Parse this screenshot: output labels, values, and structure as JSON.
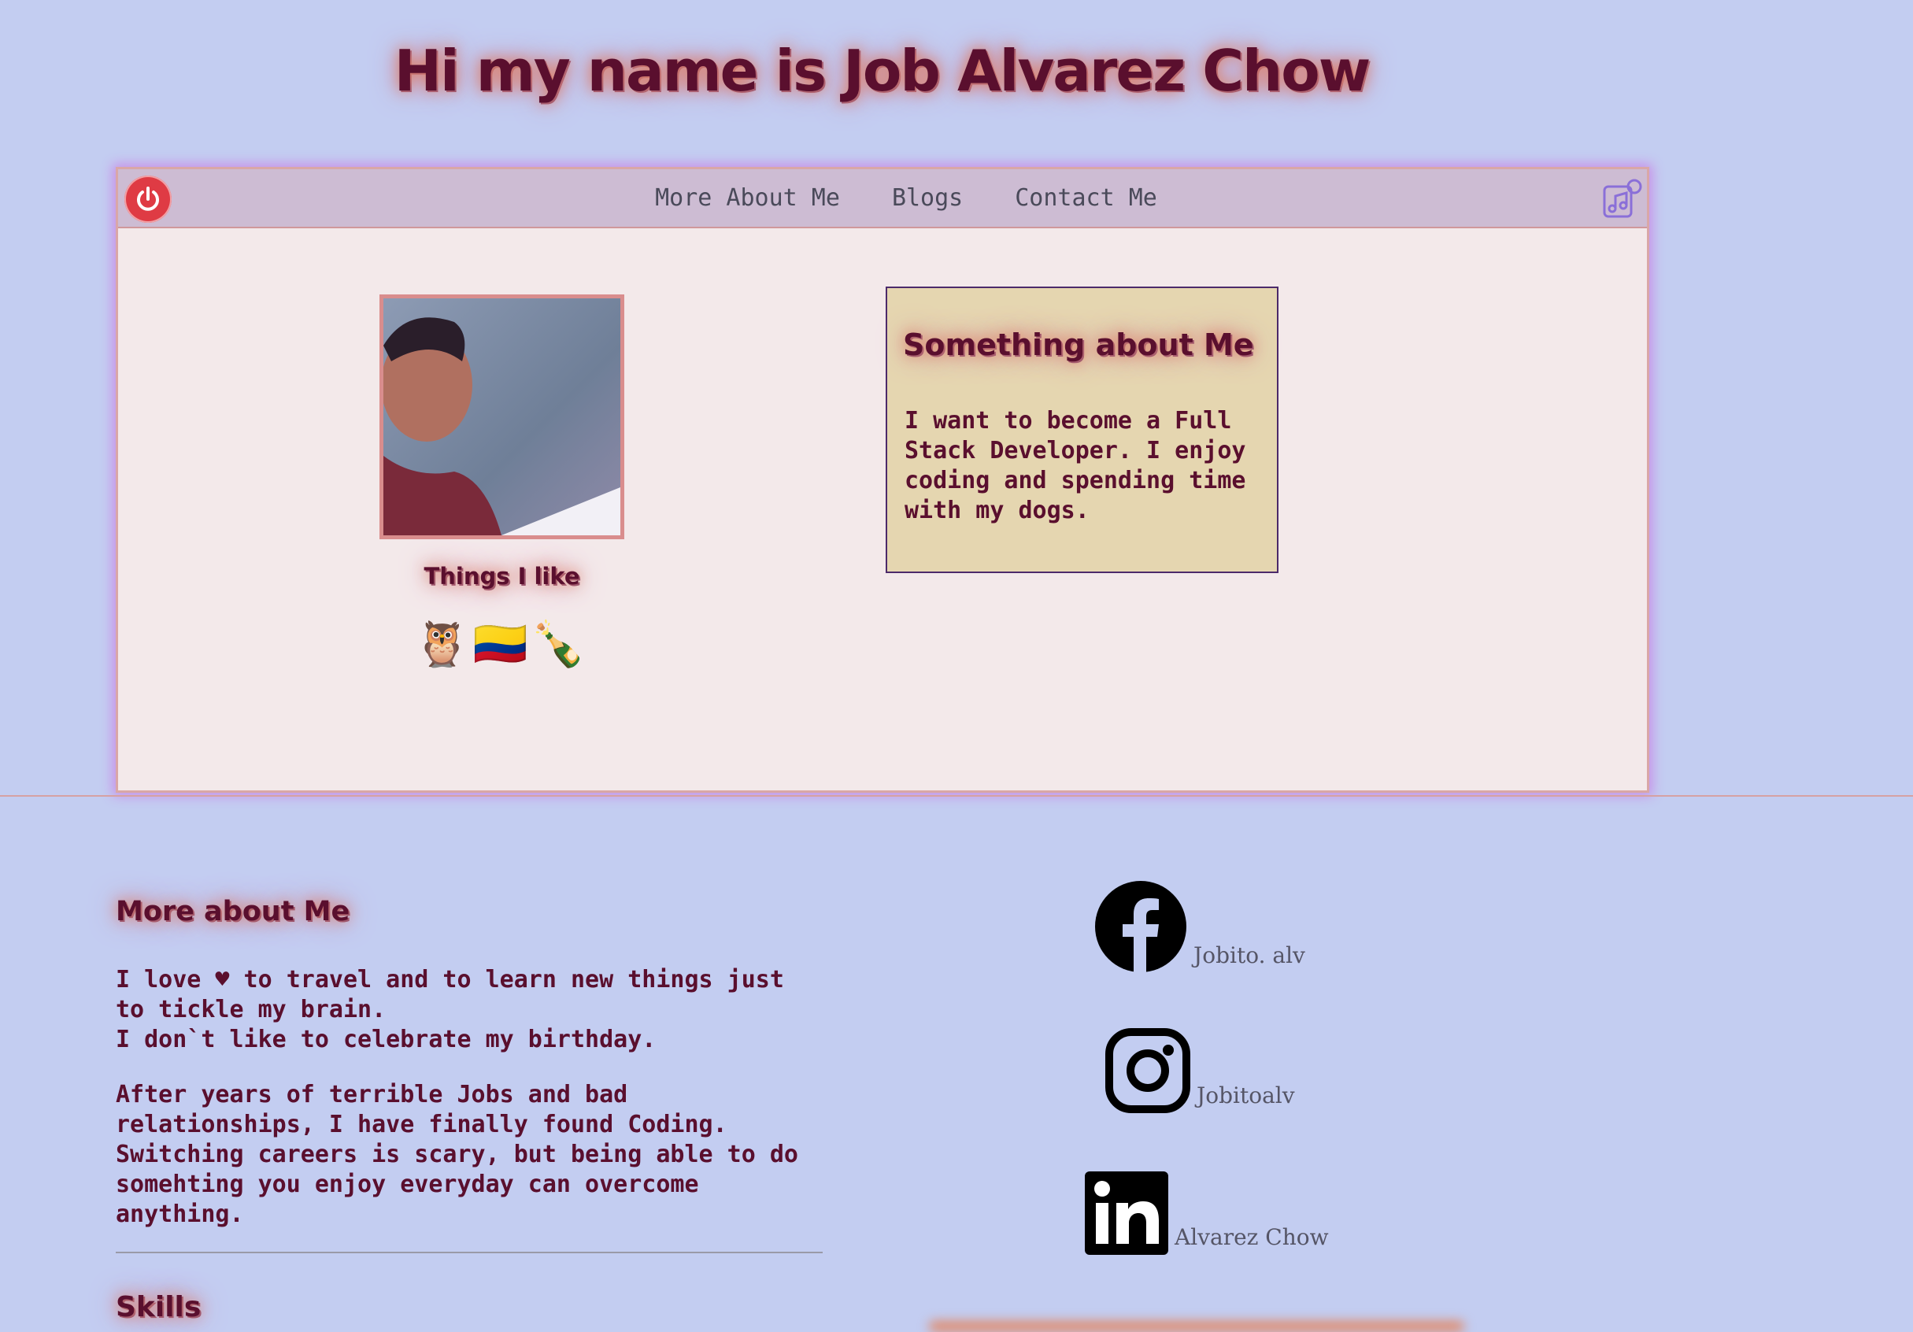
{
  "header": {
    "title": "Hi my name is Job Alvarez Chow"
  },
  "nav": {
    "links": [
      "More About Me",
      "Blogs",
      "Contact Me"
    ],
    "power_icon": "power-icon",
    "music_icon": "music-icon"
  },
  "hero": {
    "things_heading": "Things I like",
    "emojis": "🦉🇨🇴🍾",
    "about_title": "Something about Me",
    "about_text": "I want to become a Full Stack Developer. I enjoy coding and spending time with my dogs."
  },
  "more": {
    "heading": "More about Me",
    "line1": "I love ♥ to travel and to learn new things just to tickle my brain.",
    "line2": "I don`t like to celebrate my birthday.",
    "para2": "After years of terrible Jobs and bad relationships, I have finally found Coding. Switching careers is scary, but being able to do somehting you enjoy everyday can overcome anything.",
    "skills_heading": "Skills"
  },
  "social": [
    {
      "icon": "facebook-icon",
      "label": "Jobito. alv"
    },
    {
      "icon": "instagram-icon",
      "label": "Jobitoalv"
    },
    {
      "icon": "linkedin-icon",
      "label": "Alvarez Chow"
    }
  ],
  "colors": {
    "background": "#c3cdf1",
    "heading": "#5a0f2e",
    "hero_bg": "#f3e9ea",
    "navbar": "#cdbcd3",
    "about_box": "#e5d6b0"
  }
}
